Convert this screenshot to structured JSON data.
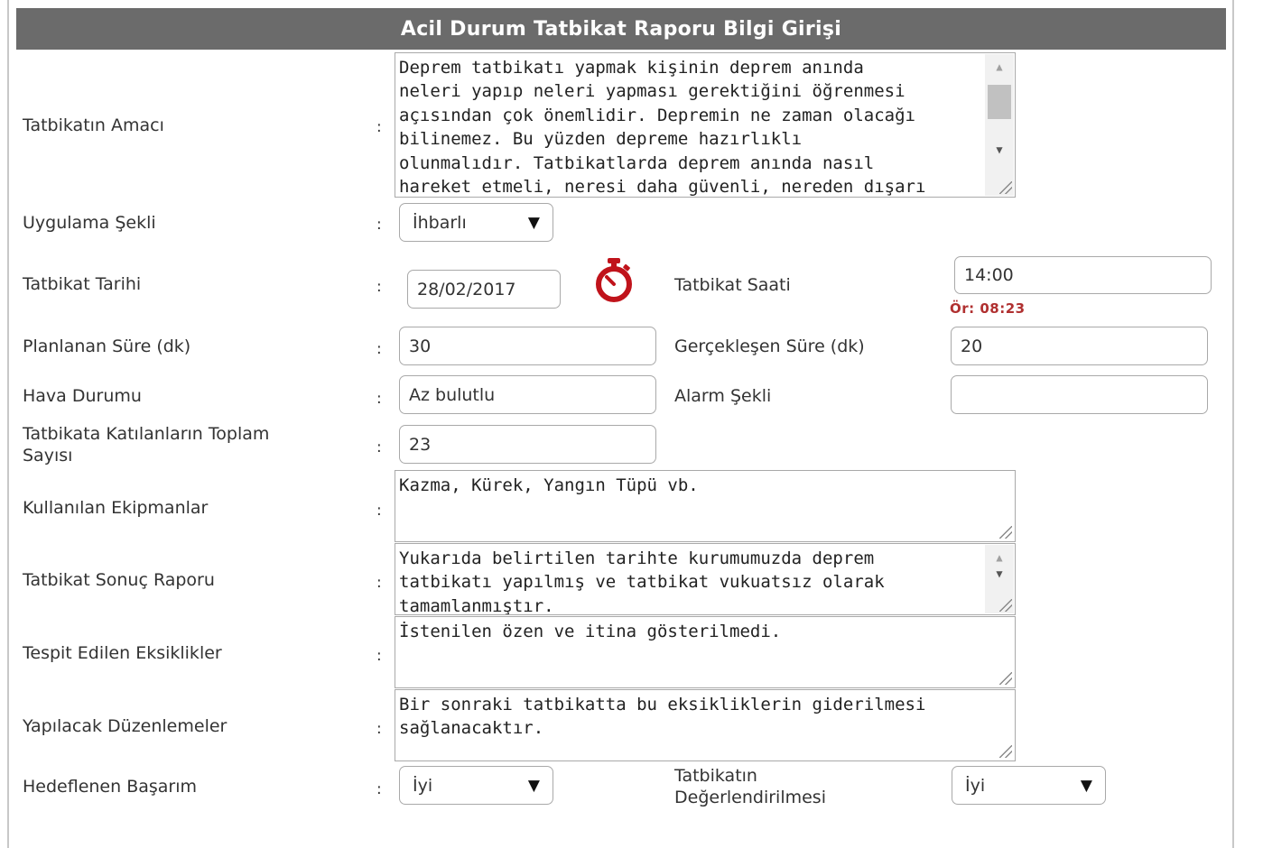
{
  "header": {
    "title": "Acil Durum Tatbikat Raporu Bilgi Girişi"
  },
  "colon": ":",
  "fields": {
    "amac": {
      "label": "Tatbikatın Amacı",
      "value": "Deprem tatbikatı yapmak kişinin deprem anında\nneleri yapıp neleri yapması gerektiğini öğrenmesi\naçısından çok önemlidir. Depremin ne zaman olacağı\nbilinemez. Bu yüzden depreme hazırlıklı\nolunmalıdır. Tatbikatlarda deprem anında nasıl\nhareket etmeli, neresi daha güvenli, nereden dışarı"
    },
    "uygulama": {
      "label": "Uygulama Şekli",
      "selected": "İhbarlı",
      "arrow": "▼"
    },
    "tarih": {
      "label": "Tatbikat Tarihi",
      "value": "28/02/2017"
    },
    "saat": {
      "label": "Tatbikat Saati",
      "value": "14:00",
      "hint": "Ör: 08:23"
    },
    "planlanan": {
      "label": "Planlanan Süre (dk)",
      "value": "30"
    },
    "gerceklesen": {
      "label": "Gerçekleşen Süre (dk)",
      "value": "20"
    },
    "hava": {
      "label": "Hava Durumu",
      "value": "Az bulutlu"
    },
    "alarm": {
      "label": "Alarm Şekli",
      "value": ""
    },
    "katilan": {
      "label_line1": "Tatbikata Katılanların Toplam",
      "label_line2": "Sayısı",
      "value": "23"
    },
    "ekipman": {
      "label": "Kullanılan Ekipmanlar",
      "value": "Kazma, Kürek, Yangın Tüpü vb."
    },
    "sonuc": {
      "label": "Tatbikat Sonuç Raporu",
      "value": "Yukarıda belirtilen tarihte kurumumuzda deprem\ntatbikatı yapılmış ve tatbikat vukuatsız olarak\ntamamlanmıştır."
    },
    "eksiklik": {
      "label": "Tespit Edilen Eksiklikler",
      "value": "İstenilen özen ve itina gösterilmedi."
    },
    "duzenleme": {
      "label": "Yapılacak Düzenlemeler",
      "value": "Bir sonraki tatbikatta bu eksikliklerin giderilmesi\nsağlanacaktır."
    },
    "basarim": {
      "label": "Hedeflenen Başarım",
      "selected": "İyi",
      "arrow": "▼"
    },
    "degerlendirme": {
      "label_line1": "Tatbikatın",
      "label_line2": "Değerlendirilmesi",
      "selected": "İyi",
      "arrow": "▼"
    }
  },
  "icons": {
    "timer": "stopwatch-icon",
    "timer_color": "#c0131b"
  }
}
